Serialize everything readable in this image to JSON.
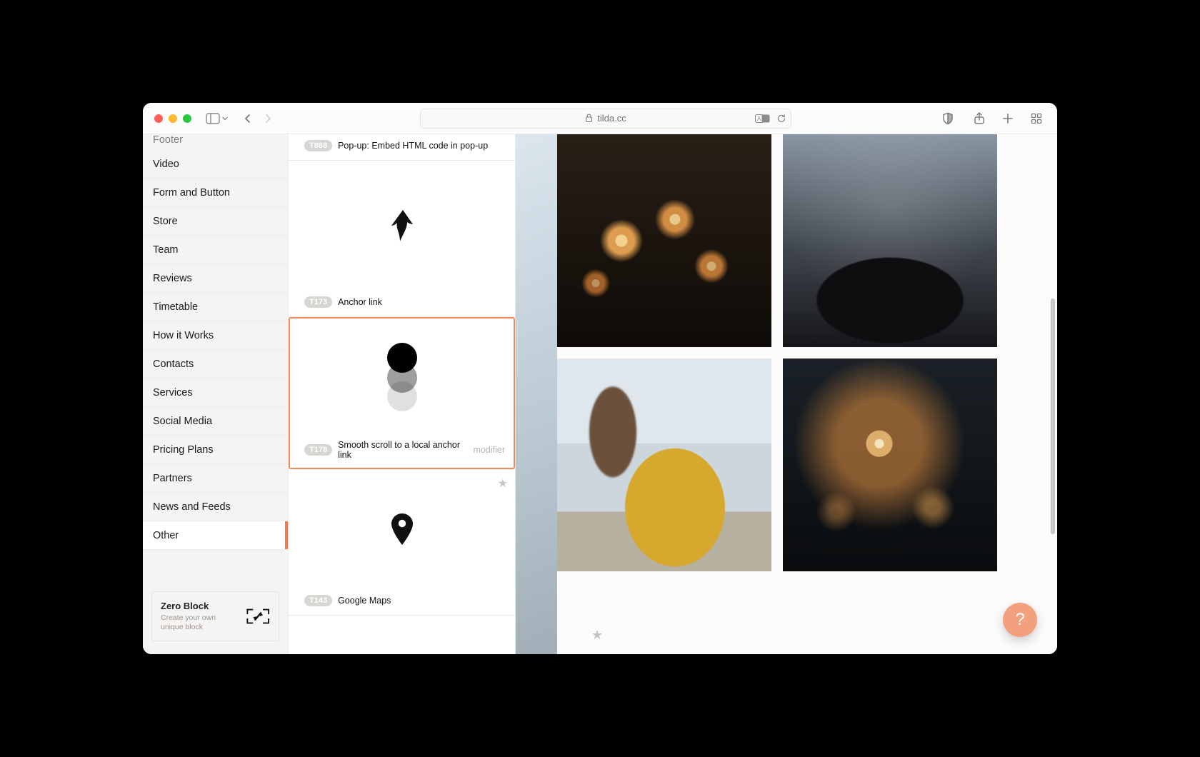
{
  "browser": {
    "url_host": "tilda.cc"
  },
  "sidebar": {
    "items": [
      {
        "label": "Footer"
      },
      {
        "label": "Video"
      },
      {
        "label": "Form and Button"
      },
      {
        "label": "Store"
      },
      {
        "label": "Team"
      },
      {
        "label": "Reviews"
      },
      {
        "label": "Timetable"
      },
      {
        "label": "How it Works"
      },
      {
        "label": "Contacts"
      },
      {
        "label": "Services"
      },
      {
        "label": "Social Media"
      },
      {
        "label": "Pricing Plans"
      },
      {
        "label": "Partners"
      },
      {
        "label": "News and Feeds"
      },
      {
        "label": "Other"
      }
    ],
    "active_index": 14,
    "zero": {
      "title": "Zero Block",
      "subtitle": "Create your own unique block"
    }
  },
  "blocks": [
    {
      "code": "T868",
      "title": "Pop-up: Embed HTML code in pop-up",
      "note": "",
      "preview": "none",
      "selected": false,
      "starred": false
    },
    {
      "code": "T173",
      "title": "Anchor link",
      "note": "",
      "preview": "arrow",
      "selected": false,
      "starred": false
    },
    {
      "code": "T178",
      "title": "Smooth scroll to a local anchor link",
      "note": "modifier",
      "preview": "dots",
      "selected": true,
      "starred": false
    },
    {
      "code": "T143",
      "title": "Google Maps",
      "note": "",
      "preview": "pin",
      "selected": false,
      "starred": true
    }
  ],
  "help_label": "?"
}
